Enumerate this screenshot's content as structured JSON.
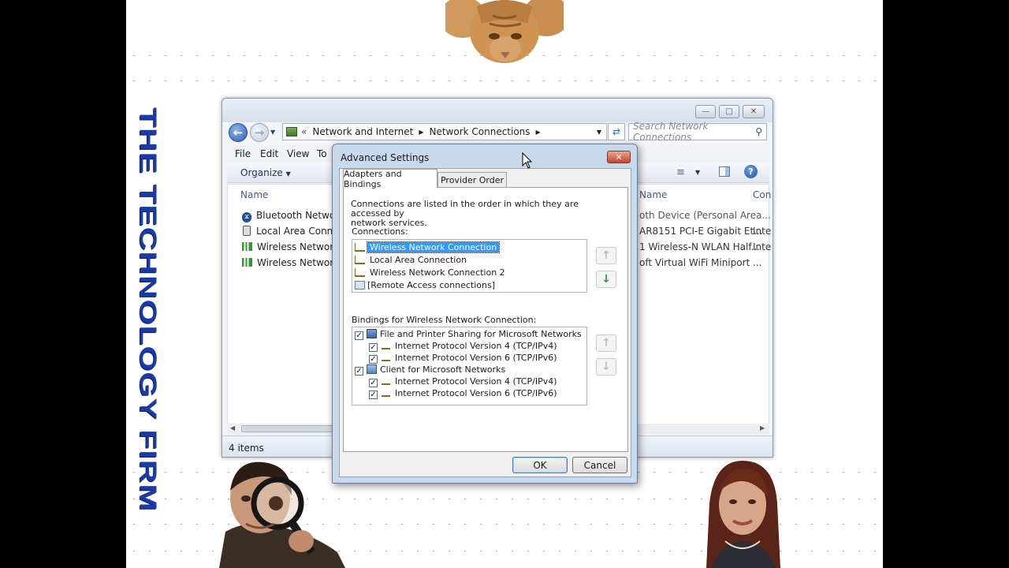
{
  "brand_text": "THE TECHNOLOGY FIRM",
  "explorer": {
    "breadcrumb": {
      "prefix": "«",
      "item1": "Network and Internet",
      "item2": "Network Connections"
    },
    "search_placeholder": "Search Network Connections",
    "menu": {
      "file": "File",
      "edit": "Edit",
      "view": "View",
      "tools": "To"
    },
    "organize": "Organize",
    "columns": {
      "name": "Name",
      "device_name": "Name",
      "connectivity": "Con"
    },
    "rows": [
      {
        "name": "Bluetooth Network",
        "device": "oth Device (Personal Area...",
        "conn": ""
      },
      {
        "name": "Local Area Connect",
        "device": "AR8151 PCI-E Gigabit Et...",
        "conn": "Inte"
      },
      {
        "name": "Wireless Network C",
        "device": "1 Wireless-N WLAN Half...",
        "conn": "Inte"
      },
      {
        "name": "Wireless Network C",
        "device": "oft Virtual WiFi Miniport ...",
        "conn": ""
      }
    ],
    "status": "4 items"
  },
  "dialog": {
    "title": "Advanced Settings",
    "close_glyph": "✕",
    "tabs": {
      "adapters": "Adapters and Bindings",
      "provider": "Provider Order"
    },
    "description_line1": "Connections are listed in the order in which they are accessed by",
    "description_line2": "network services.",
    "connections_label": "Connections:",
    "connections": [
      "Wireless Network Connection",
      "Local Area Connection",
      "Wireless Network Connection 2",
      "[Remote Access connections]"
    ],
    "bindings_label": "Bindings for Wireless Network Connection:",
    "bindings": [
      {
        "label": "File and Printer Sharing for Microsoft Networks",
        "checked": true
      },
      {
        "label": "Internet Protocol Version 4 (TCP/IPv4)",
        "checked": true
      },
      {
        "label": "Internet Protocol Version 6 (TCP/IPv6)",
        "checked": true
      },
      {
        "label": "Client for Microsoft Networks",
        "checked": true
      },
      {
        "label": "Internet Protocol Version 4 (TCP/IPv4)",
        "checked": true
      },
      {
        "label": "Internet Protocol Version 6 (TCP/IPv6)",
        "checked": true
      }
    ],
    "ok": "OK",
    "cancel": "Cancel"
  }
}
